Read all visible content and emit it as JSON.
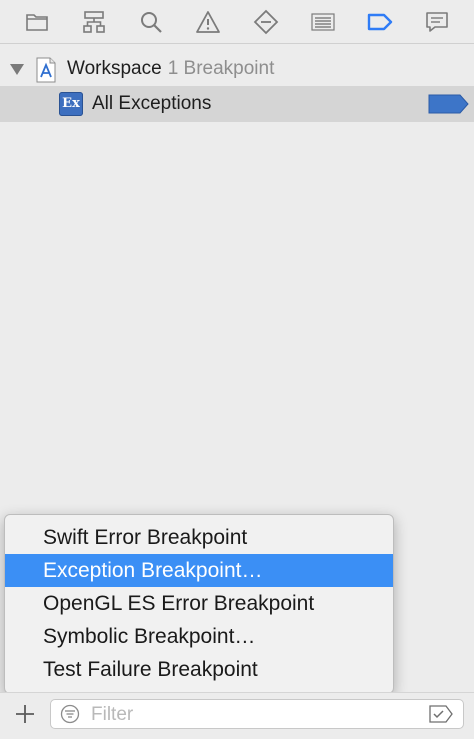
{
  "toolbar": {
    "buttons": [
      {
        "name": "project-navigator-folder-icon"
      },
      {
        "name": "symbol-navigator-hierarchy-icon"
      },
      {
        "name": "find-navigator-search-icon"
      },
      {
        "name": "issue-navigator-warning-icon"
      },
      {
        "name": "test-navigator-diamond-icon"
      },
      {
        "name": "debug-navigator-list-icon"
      },
      {
        "name": "breakpoint-navigator-icon",
        "active": true
      },
      {
        "name": "report-navigator-speech-bubble-icon"
      }
    ],
    "active_color": "#2f7cf6",
    "icon_color": "#7b7b7b"
  },
  "workspace": {
    "name": "Workspace",
    "count": "1 Breakpoint"
  },
  "breakpoint": {
    "badge": "Ex",
    "label": "All Exceptions",
    "flag_color": "#3d75c8"
  },
  "menu": {
    "items": [
      {
        "label": "Swift Error Breakpoint",
        "selected": false
      },
      {
        "label": "Exception Breakpoint…",
        "selected": true
      },
      {
        "label": "OpenGL ES Error Breakpoint",
        "selected": false
      },
      {
        "label": "Symbolic Breakpoint…",
        "selected": false
      },
      {
        "label": "Test Failure Breakpoint",
        "selected": false
      }
    ],
    "highlight_color": "#3b8ff5"
  },
  "filter": {
    "placeholder": "Filter"
  }
}
